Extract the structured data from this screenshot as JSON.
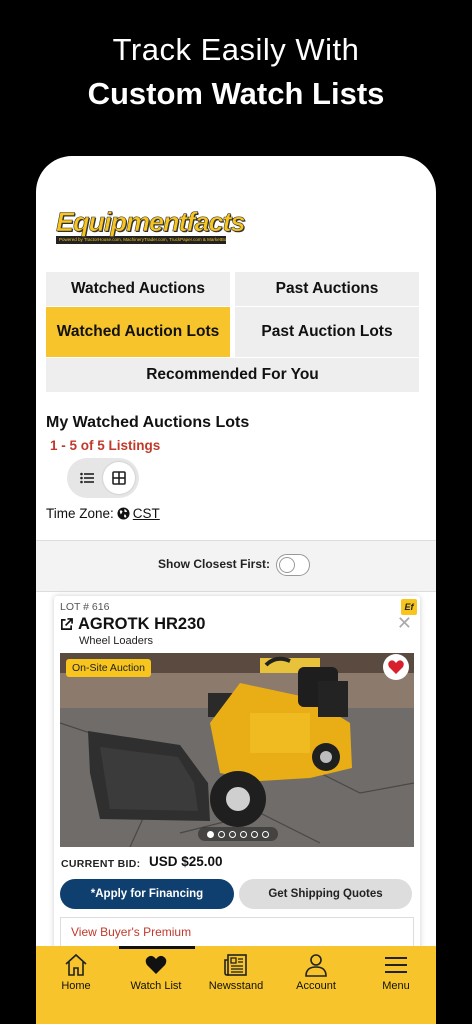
{
  "headline": {
    "line1": "Track Easily With",
    "line2": "Custom Watch Lists"
  },
  "logo": {
    "word": "Equipmentfacts",
    "tagline": "Powered by TractorHouse.com, MachineryTrader.com, TruckPaper.com & MarketBook.com"
  },
  "tabs": [
    {
      "label": "Watched Auctions",
      "active": false
    },
    {
      "label": "Past Auctions",
      "active": false
    },
    {
      "label": "Watched Auction Lots",
      "active": true
    },
    {
      "label": "Past Auction Lots",
      "active": false
    },
    {
      "label": "Recommended For You",
      "active": false
    }
  ],
  "section": {
    "title": "My Watched Auctions Lots",
    "count": "1 - 5 of 5 Listings"
  },
  "timezone": {
    "label": "Time Zone:",
    "value": "CST"
  },
  "closest": {
    "label": "Show Closest First:",
    "on": false
  },
  "listing": {
    "lot": "LOT # 616",
    "badge": "Ef",
    "title": "AGROTK HR230",
    "category": "Wheel Loaders",
    "tag": "On-Site Auction",
    "photo_count": 6,
    "photo_index": 1,
    "bid_label": "CURRENT BID:",
    "bid_value": "USD $25.00",
    "finance_label": "*Apply for Financing",
    "shipping_label": "Get Shipping Quotes",
    "premium_label": "View Buyer's Premium"
  },
  "nav": [
    {
      "label": "Home",
      "icon": "home-icon"
    },
    {
      "label": "Watch List",
      "icon": "heart-icon",
      "active": true
    },
    {
      "label": "Newsstand",
      "icon": "newspaper-icon"
    },
    {
      "label": "Account",
      "icon": "user-icon"
    },
    {
      "label": "Menu",
      "icon": "hamburger-icon"
    }
  ],
  "colors": {
    "accent": "#f7c52b",
    "finance_button": "#0f3f6e",
    "count_red": "#c0392b"
  }
}
